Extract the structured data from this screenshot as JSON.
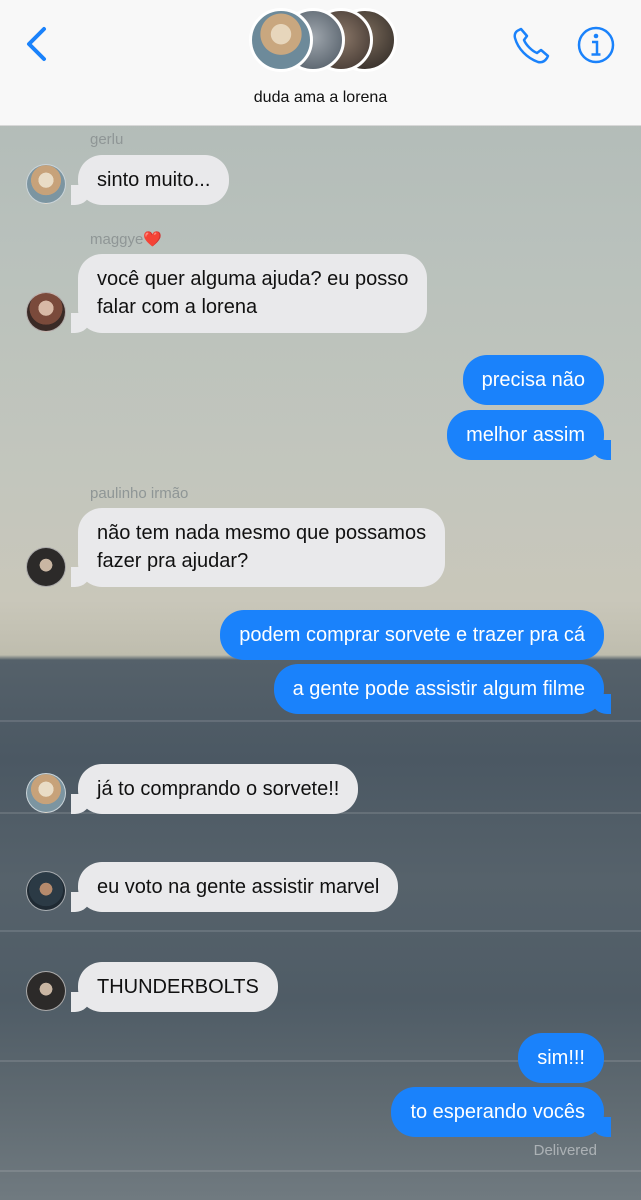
{
  "header": {
    "group_name": "duda ama a lorena",
    "icons": {
      "back": "chevron-left-icon",
      "call": "phone-icon",
      "info": "info-icon"
    },
    "accent_color": "#1a82fb"
  },
  "messages": [
    {
      "sender": "gerlu",
      "text": "sinto muito..."
    },
    {
      "sender": "maggye❤️",
      "lines": [
        "você quer alguma ajuda? eu posso",
        "falar com a lorena"
      ]
    },
    {
      "text": "precisa não"
    },
    {
      "text": "melhor assim"
    },
    {
      "sender": "paulinho irmão",
      "lines": [
        "não tem nada mesmo que possamos",
        "fazer pra ajudar?"
      ]
    },
    {
      "text": "podem comprar sorvete e trazer pra cá"
    },
    {
      "text": "a gente pode assistir algum filme"
    },
    {
      "text": "já to comprando o sorvete!!"
    },
    {
      "text": "eu voto na gente assistir marvel"
    },
    {
      "text": "THUNDERBOLTS"
    },
    {
      "text": "sim!!!"
    },
    {
      "text": "to esperando vocês"
    }
  ],
  "status": {
    "delivered": "Delivered"
  },
  "colors": {
    "incoming_bubble": "#e9e9eb",
    "outgoing_bubble": "#1a82fb"
  }
}
